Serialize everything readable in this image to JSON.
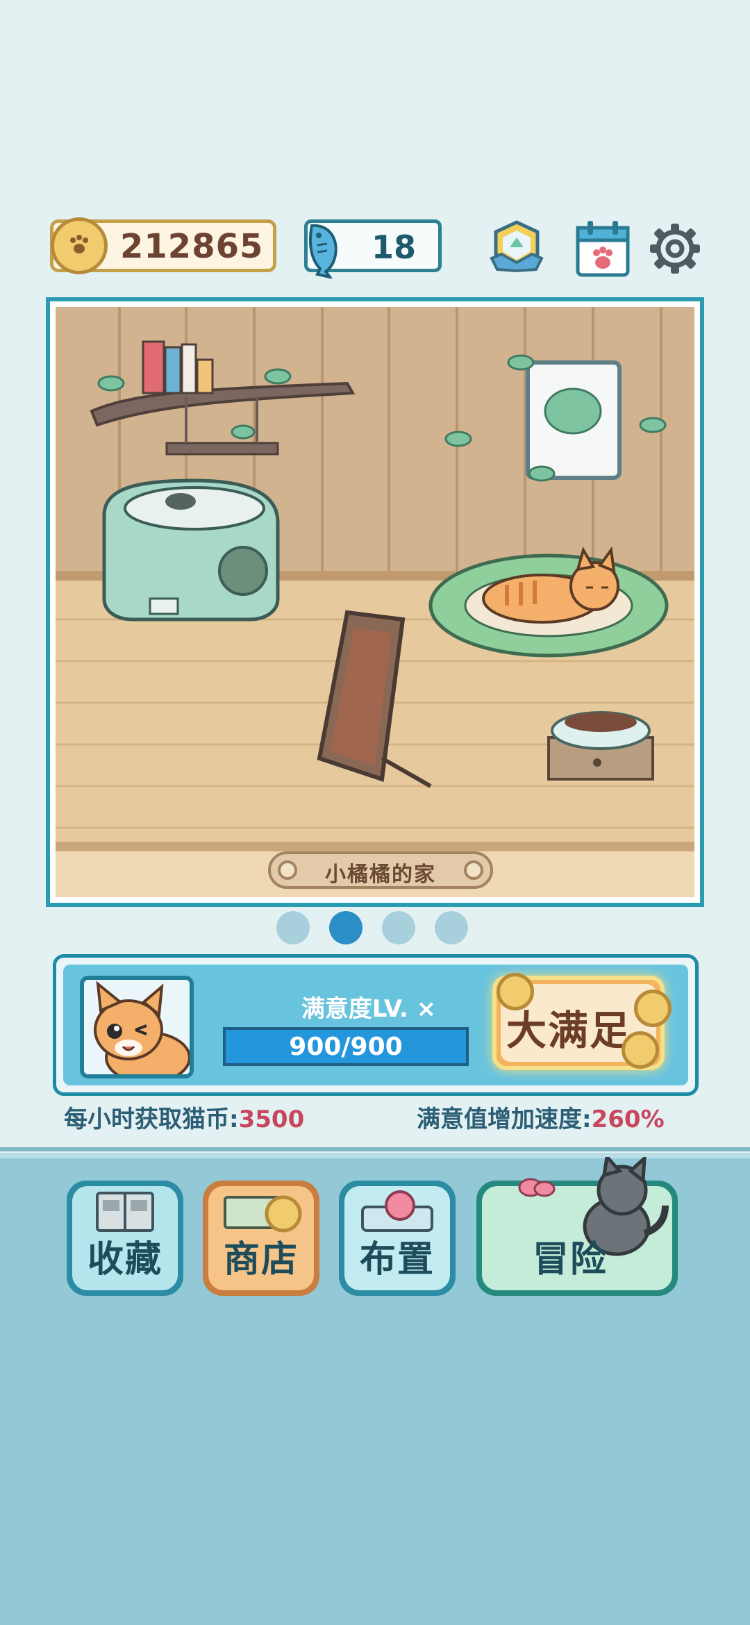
{
  "hud": {
    "coins": "212865",
    "fish": "18"
  },
  "room": {
    "name": "小橘橘的家",
    "pages": 4,
    "active_page": 2
  },
  "satisfaction": {
    "level_label": "满意度LV. ×",
    "progress_text": "900/900",
    "progress_fraction": 1.0,
    "button_label": "大满足"
  },
  "stats": {
    "coins_per_hour_label": "每小时获取猫币:",
    "coins_per_hour_value": "3500",
    "speed_label": "满意值增加速度:",
    "speed_value": "260%"
  },
  "menu": {
    "collection": "收藏",
    "shop": "商店",
    "layout": "布置",
    "adventure": "冒险"
  },
  "colors": {
    "accent": "#2a9bb0",
    "coin": "#f1cc6e",
    "highlight_value": "#c8465e",
    "bottom_bg": "#93c9d7"
  }
}
